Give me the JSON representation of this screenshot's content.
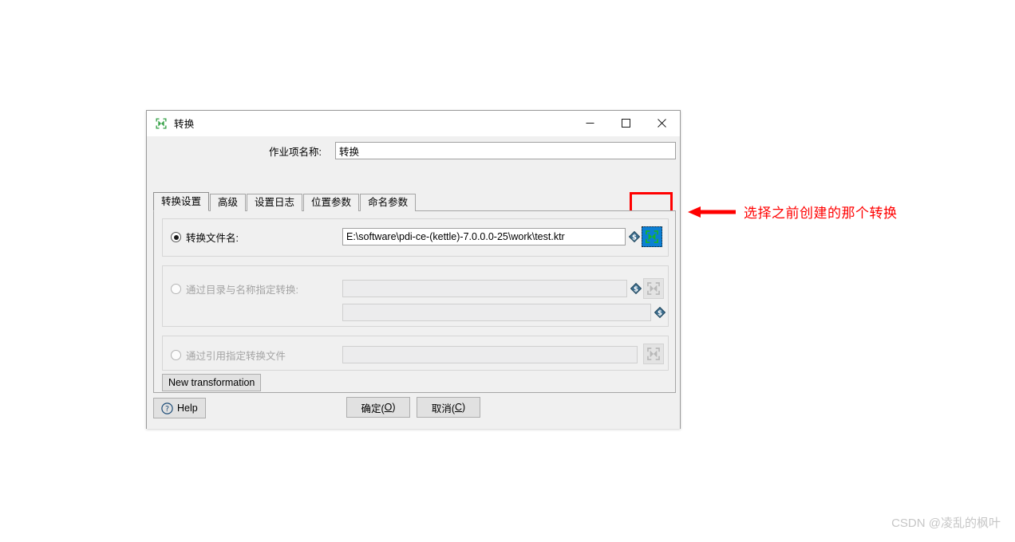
{
  "window": {
    "title": "转换",
    "icon": "transformation-icon",
    "controls": {
      "minimize": "minimize-icon",
      "maximize": "maximize-icon",
      "close": "close-icon"
    }
  },
  "form": {
    "job_name_label": "作业项名称:",
    "job_name_value": "转换"
  },
  "tabs": [
    {
      "label": "转换设置",
      "active": true
    },
    {
      "label": "高级",
      "active": false
    },
    {
      "label": "设置日志",
      "active": false
    },
    {
      "label": "位置参数",
      "active": false
    },
    {
      "label": "命名参数",
      "active": false
    }
  ],
  "options": {
    "by_filename": {
      "label": "转换文件名:",
      "selected": true,
      "enabled": true,
      "value": "E:\\software\\pdi-ce-(kettle)-7.0.0.0-25\\work\\test.ktr",
      "variable_icon": "variable-diamond-icon",
      "browse_icon": "transformation-select-icon"
    },
    "by_directory": {
      "label": "通过目录与名称指定转换:",
      "selected": false,
      "enabled": false,
      "value_directory": "",
      "value_name": "",
      "variable_icon": "variable-diamond-icon",
      "browse_icon": "transformation-select-icon"
    },
    "by_reference": {
      "label": "通过引用指定转换文件",
      "selected": false,
      "enabled": false,
      "value": "",
      "browse_icon": "transformation-select-icon"
    }
  },
  "buttons": {
    "new_transformation": "New transformation",
    "help": "Help",
    "help_icon": "question-circle-icon",
    "ok_prefix": "确定(",
    "ok_mnemonic": "O",
    "ok_suffix": ")",
    "cancel_prefix": "取消(",
    "cancel_mnemonic": "C",
    "cancel_suffix": ")"
  },
  "annotation": {
    "text": "选择之前创建的那个转换",
    "arrow": "left-arrow-icon",
    "color": "#ff0000",
    "highlight_color": "#ff0000"
  },
  "watermark": {
    "text": "CSDN @凌乱的枫叶"
  }
}
